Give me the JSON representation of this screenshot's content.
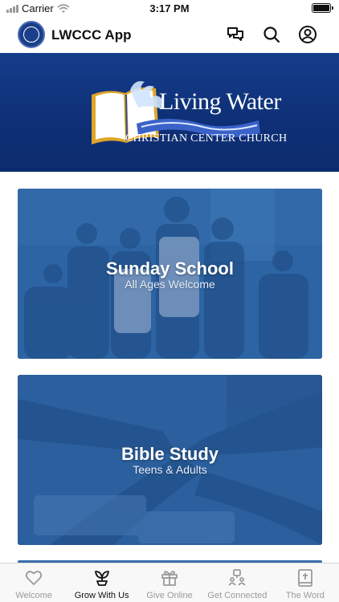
{
  "status_bar": {
    "carrier": "Carrier",
    "time": "3:17 PM",
    "battery_level": 1.0
  },
  "header": {
    "title": "LWCCC App",
    "icons": [
      "chat-icon",
      "search-icon",
      "account-icon"
    ]
  },
  "banner": {
    "brand_name": "Living Water",
    "brand_subtitle": "CHRISTIAN CENTER CHURCH"
  },
  "cards": [
    {
      "title": "Sunday School",
      "subtitle": "All Ages Welcome"
    },
    {
      "title": "Bible Study",
      "subtitle": "Teens & Adults"
    }
  ],
  "tabs": [
    {
      "label": "Welcome",
      "icon": "heart-icon",
      "active": false
    },
    {
      "label": "Grow With Us",
      "icon": "sprout-icon",
      "active": true
    },
    {
      "label": "Give Online",
      "icon": "gift-icon",
      "active": false
    },
    {
      "label": "Get Connected",
      "icon": "people-icon",
      "active": false
    },
    {
      "label": "The Word",
      "icon": "bible-icon",
      "active": false
    }
  ],
  "colors": {
    "banner_blue": "#0e2f76",
    "card_overlay": "#2e66a5",
    "tab_active": "#111111",
    "tab_inactive": "#9a9a9a"
  }
}
